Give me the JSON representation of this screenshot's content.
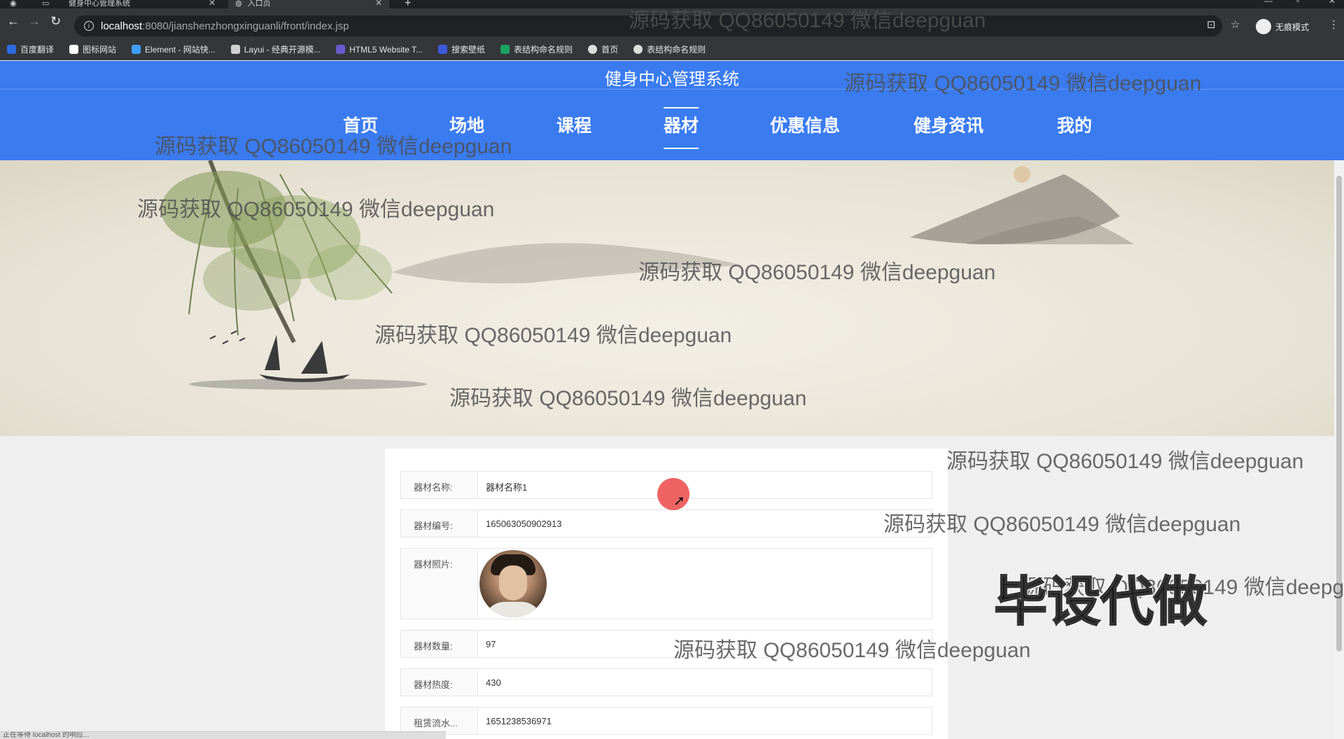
{
  "browser": {
    "tabs": [
      {
        "title": "健身中心管理系统"
      },
      {
        "title": "入口页"
      }
    ],
    "url_host": "localhost",
    "url_path": ":8080/jianshenzhongxinguanli/front/index.jsp",
    "profile_label": "无痕模式",
    "bookmarks": [
      {
        "label": "百度翻译",
        "color": "#2b6de0"
      },
      {
        "label": "图标网站",
        "color": "#ffffff"
      },
      {
        "label": "Element - 网站快...",
        "color": "#409eff"
      },
      {
        "label": "Layui - 经典开源模...",
        "color": "#cfcfcf"
      },
      {
        "label": "HTML5 Website T...",
        "color": "#6a5acd"
      },
      {
        "label": "搜索壁纸",
        "color": "#3b5bdb"
      },
      {
        "label": "表结构命名规则",
        "color": "#1aa260"
      },
      {
        "label": "首页",
        "color": "#dddddd"
      },
      {
        "label": "表结构命名规则",
        "color": "#dddddd"
      }
    ],
    "status_text": "正在等待 localhost 的响应..."
  },
  "site": {
    "title": "健身中心管理系统",
    "accent": "#3a7bf0",
    "nav": [
      {
        "label": "首页"
      },
      {
        "label": "场地"
      },
      {
        "label": "课程"
      },
      {
        "label": "器材",
        "active": true
      },
      {
        "label": "优惠信息"
      },
      {
        "label": "健身资讯"
      },
      {
        "label": "我的"
      }
    ]
  },
  "detail": {
    "rows": [
      {
        "label": "器材名称:",
        "value": "器材名称1"
      },
      {
        "label": "器材编号:",
        "value": "165063050902913"
      },
      {
        "label": "器材照片:",
        "value": ""
      },
      {
        "label": "器材数量:",
        "value": "97"
      },
      {
        "label": "器材热度:",
        "value": "430"
      },
      {
        "label": "租赁流水...",
        "value": "1651238536971"
      }
    ]
  },
  "watermark": {
    "text": "源码获取 QQ86050149 微信deepguan",
    "big_text": "毕设代做"
  }
}
